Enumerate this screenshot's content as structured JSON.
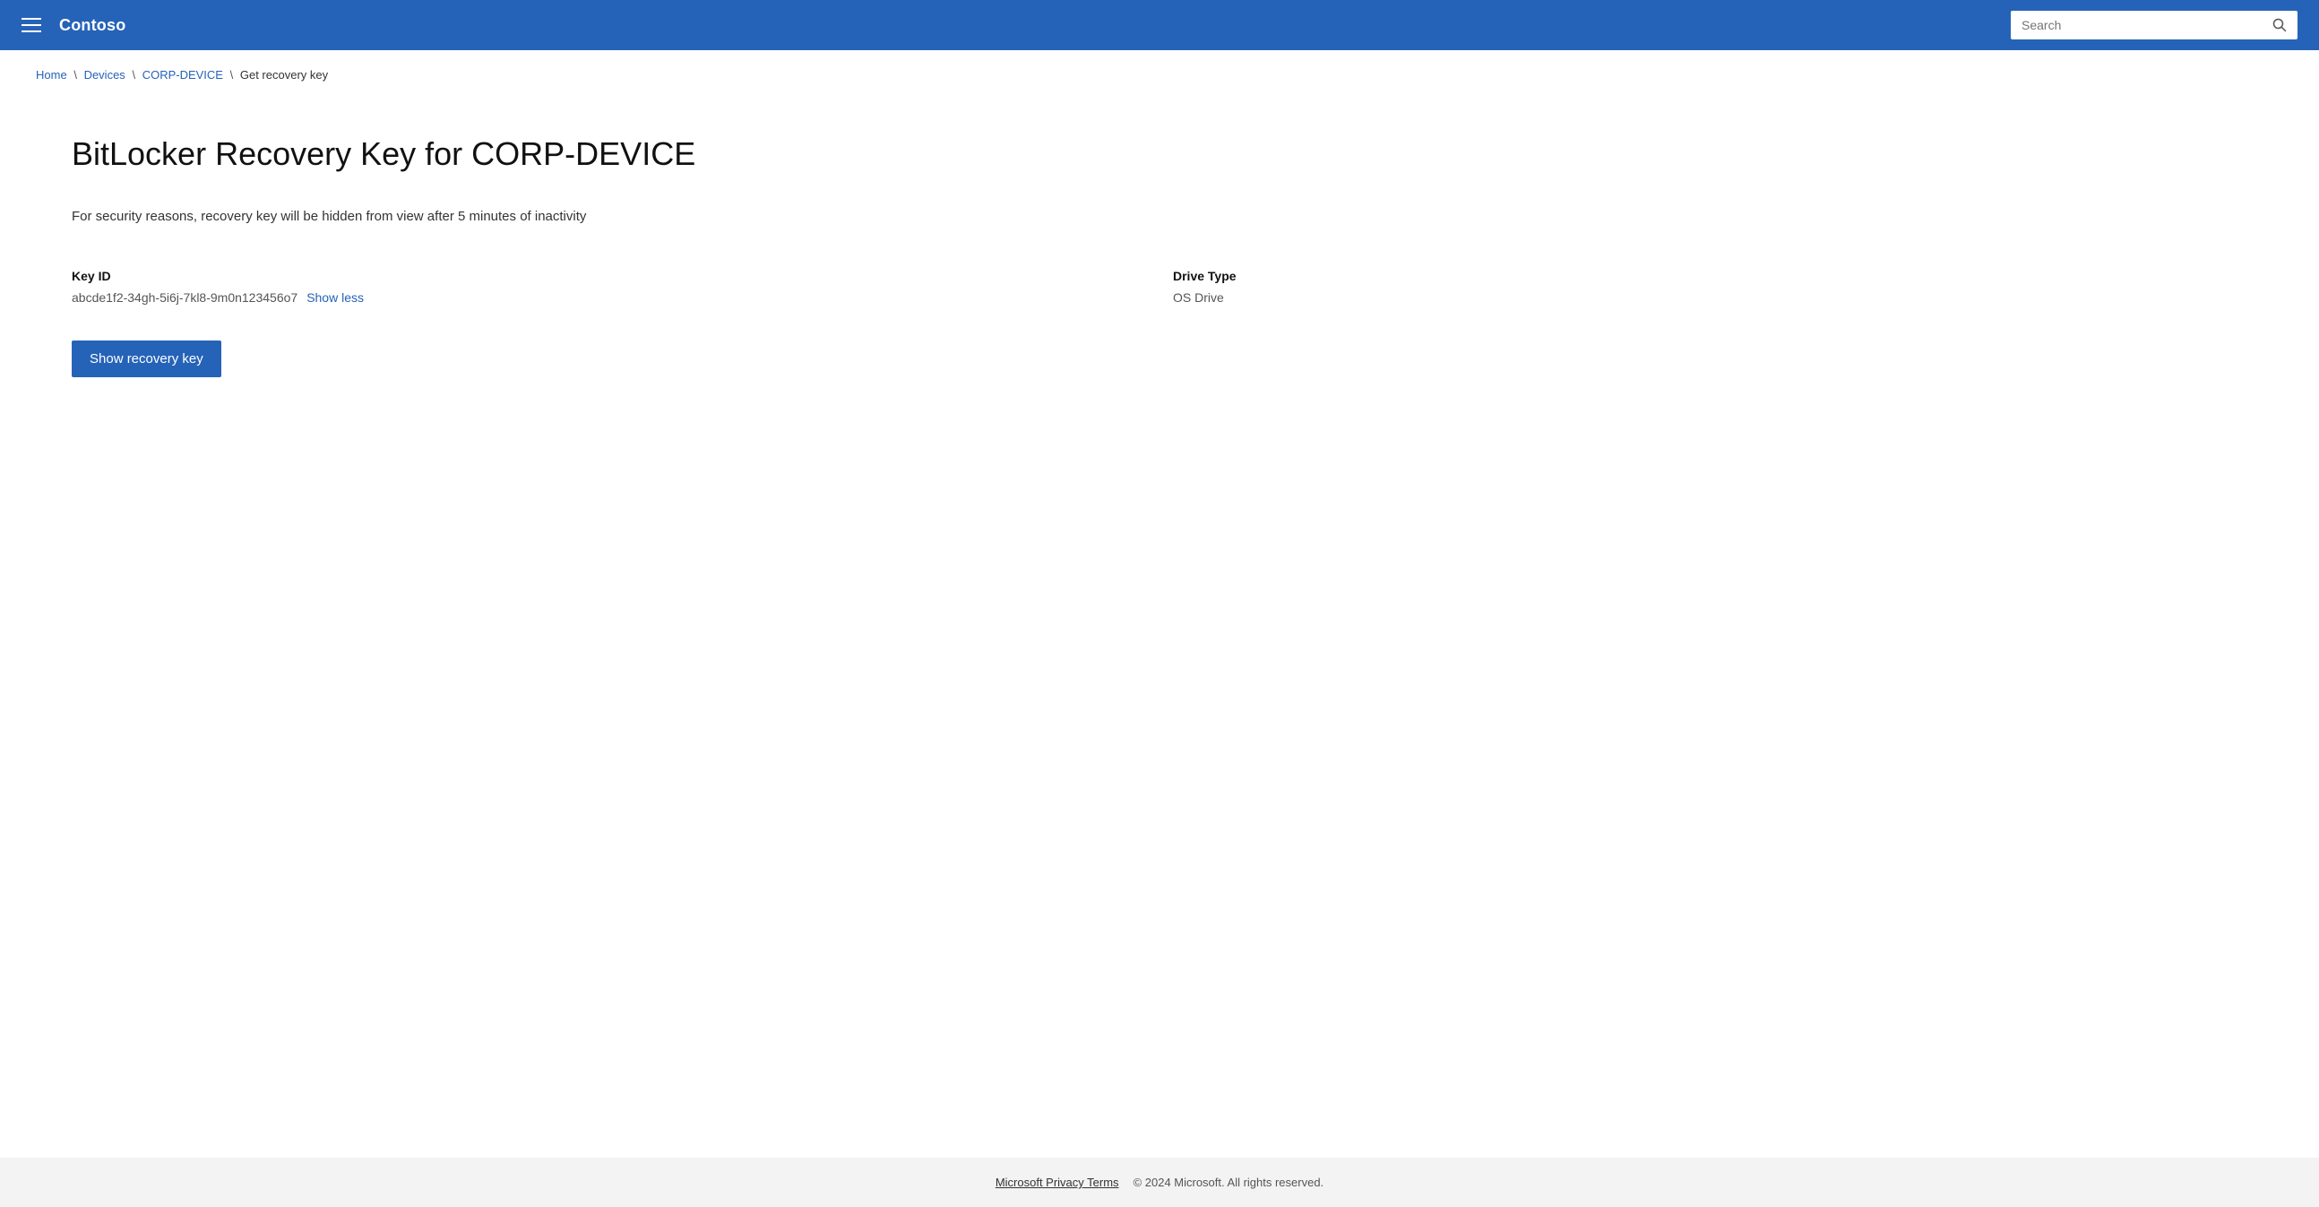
{
  "header": {
    "app_title": "Contoso",
    "search_placeholder": "Search"
  },
  "breadcrumb": {
    "home": "Home",
    "devices": "Devices",
    "device_name": "CORP-DEVICE",
    "current": "Get recovery key"
  },
  "main": {
    "page_title": "BitLocker Recovery Key for CORP-DEVICE",
    "security_notice": "For security reasons, recovery key will be hidden from view after 5 minutes of inactivity",
    "key_id_label": "Key ID",
    "key_id_value": "abcde1f2-34gh-5i6j-7kl8-9m0n123456o7",
    "show_less_link": "Show less",
    "drive_type_label": "Drive Type",
    "drive_type_value": "OS Drive",
    "show_recovery_key_button": "Show recovery key"
  },
  "footer": {
    "privacy_link": "Microsoft Privacy Terms",
    "copyright": "© 2024 Microsoft. All rights reserved."
  }
}
